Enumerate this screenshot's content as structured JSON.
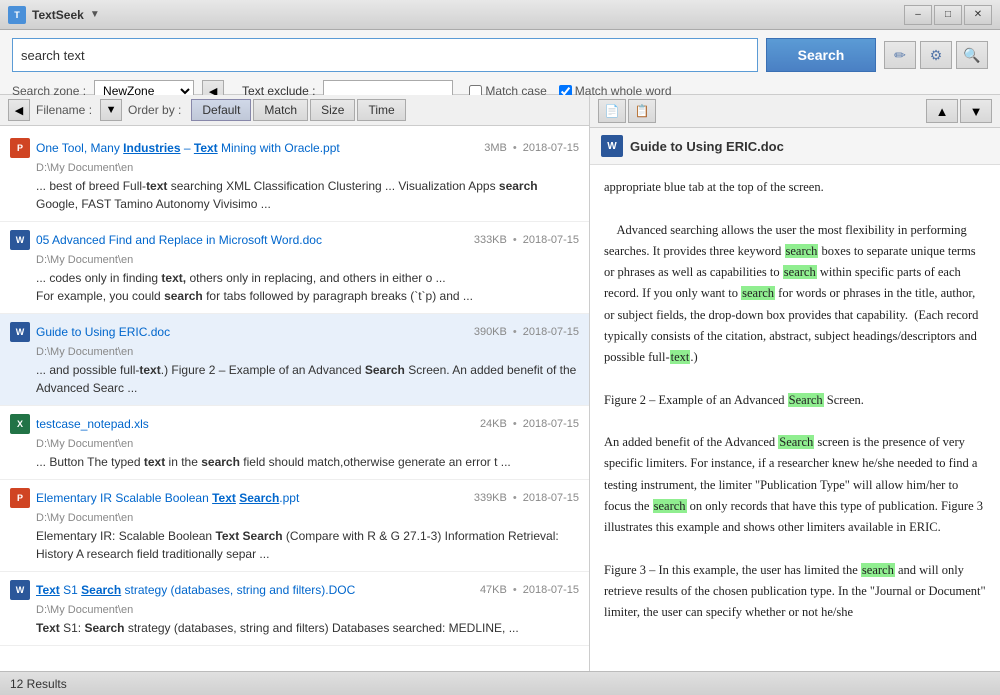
{
  "app": {
    "title": "TextSeek",
    "icon": "T"
  },
  "titlebar": {
    "minimize": "–",
    "restore": "□",
    "close": "✕"
  },
  "search": {
    "input_value": "search text",
    "button_label": "Search",
    "zone_label": "Search zone :",
    "zone_value": "NewZone",
    "text_exclude_label": "Text exclude :",
    "match_case_label": "Match case",
    "match_whole_word_label": "Match whole word",
    "match_case_checked": false,
    "match_whole_word_checked": true
  },
  "toolbar": {
    "edit_icon": "✏",
    "settings_icon": "⚙",
    "search_icon": "🔍"
  },
  "sort_bar": {
    "filename_label": "Filename :",
    "order_by_label": "Order by :",
    "default_btn": "Default",
    "match_btn": "Match",
    "size_btn": "Size",
    "time_btn": "Time"
  },
  "file_list": [
    {
      "id": 1,
      "type": "ppt",
      "title_parts": [
        "One Tool, Many ",
        "Industries",
        " – ",
        "Text",
        " Mining with Oracle.ppt"
      ],
      "title_highlights": [
        1,
        3
      ],
      "path": "D:\\My Document\\en",
      "size": "3MB",
      "date": "2018-07-15",
      "excerpt": "... best of breed Full-text searching XML Classification Clustering ... Visualization Apps search Google, FAST Tamino Autonomy Vivisimo ..."
    },
    {
      "id": 2,
      "type": "doc",
      "title_parts": [
        "05 Advanced Find and Replace in ",
        "Microsoft",
        " Word.doc"
      ],
      "title_highlights": [],
      "path": "D:\\My Document\\en",
      "size": "333KB",
      "date": "2018-07-15",
      "excerpt": "... codes only in finding text, others only in replacing, and others in either o ... For example, you could search for tabs followed by paragraph breaks (`t`p) and ..."
    },
    {
      "id": 3,
      "type": "doc",
      "title_parts": [
        "Guide to Using ERIC.doc"
      ],
      "title_highlights": [],
      "path": "D:\\My Document\\en",
      "size": "390KB",
      "date": "2018-07-15",
      "excerpt": "... and possible full-text.) Figure 2 – Example of an Advanced Search Screen. An added benefit of the Advanced Searc ..."
    },
    {
      "id": 4,
      "type": "xls",
      "title_parts": [
        "testcase_notepad.xls"
      ],
      "title_highlights": [],
      "path": "D:\\My Document\\en",
      "size": "24KB",
      "date": "2018-07-15",
      "excerpt": "... Button The typed text in the search field should match,otherwise generate an error t ..."
    },
    {
      "id": 5,
      "type": "ppt",
      "title_parts": [
        "Elementary IR Scalable Boolean ",
        "Text",
        " ",
        "Search",
        ".ppt"
      ],
      "title_highlights": [
        1,
        3
      ],
      "path": "D:\\My Document\\en",
      "size": "339KB",
      "date": "2018-07-15",
      "excerpt": "Elementary IR: Scalable Boolean Text Search (Compare with R & G 27.1-3) Information Retrieval: History A research field traditionally separ ..."
    },
    {
      "id": 6,
      "type": "doc",
      "title_parts": [
        "Text",
        " S1 ",
        "Search",
        " strategy (databases, string and filters).DOC"
      ],
      "title_highlights": [
        0,
        2
      ],
      "path": "D:\\My Document\\en",
      "size": "47KB",
      "date": "2018-07-15",
      "excerpt": "Text S1: Search strategy (databases, string and filters) Databases searched: MEDLINE, ..."
    }
  ],
  "preview": {
    "doc_title": "Guide to Using ERIC.doc",
    "doc_icon_type": "word",
    "content_paragraphs": [
      "appropriate blue tab at the top of the screen.",
      "    Advanced searching allows the user the most flexibility in performing searches. It provides three keyword search boxes to separate unique terms or phrases as well as capabilities to search within specific parts of each record. If you only want to search for words or phrases in the title, author, or subject fields, the drop-down box provides that capability. (Each record typically consists of the citation, abstract, subject headings/descriptors and possible full-text.)",
      "Figure 2 – Example of an Advanced Search Screen.",
      "An added benefit of the Advanced Search screen is the presence of very specific limiters. For instance, if a researcher knew he/she needed to find a testing instrument, the limiter “Publication Type” will allow him/her to focus the search on only records that have this type of publication. Figure 3 illustrates this example and shows other limiters available in ERIC.",
      "Figure 3 – In this example, the user has limited the search and will only retrieve results of the chosen publication type. In the “Journal or Document” limiter, the user can specify whether or not he/she"
    ],
    "search_highlights": [
      "search",
      "search",
      "search",
      "Search",
      "Search",
      "search",
      "search"
    ]
  },
  "status_bar": {
    "results_count": "12 Results"
  }
}
